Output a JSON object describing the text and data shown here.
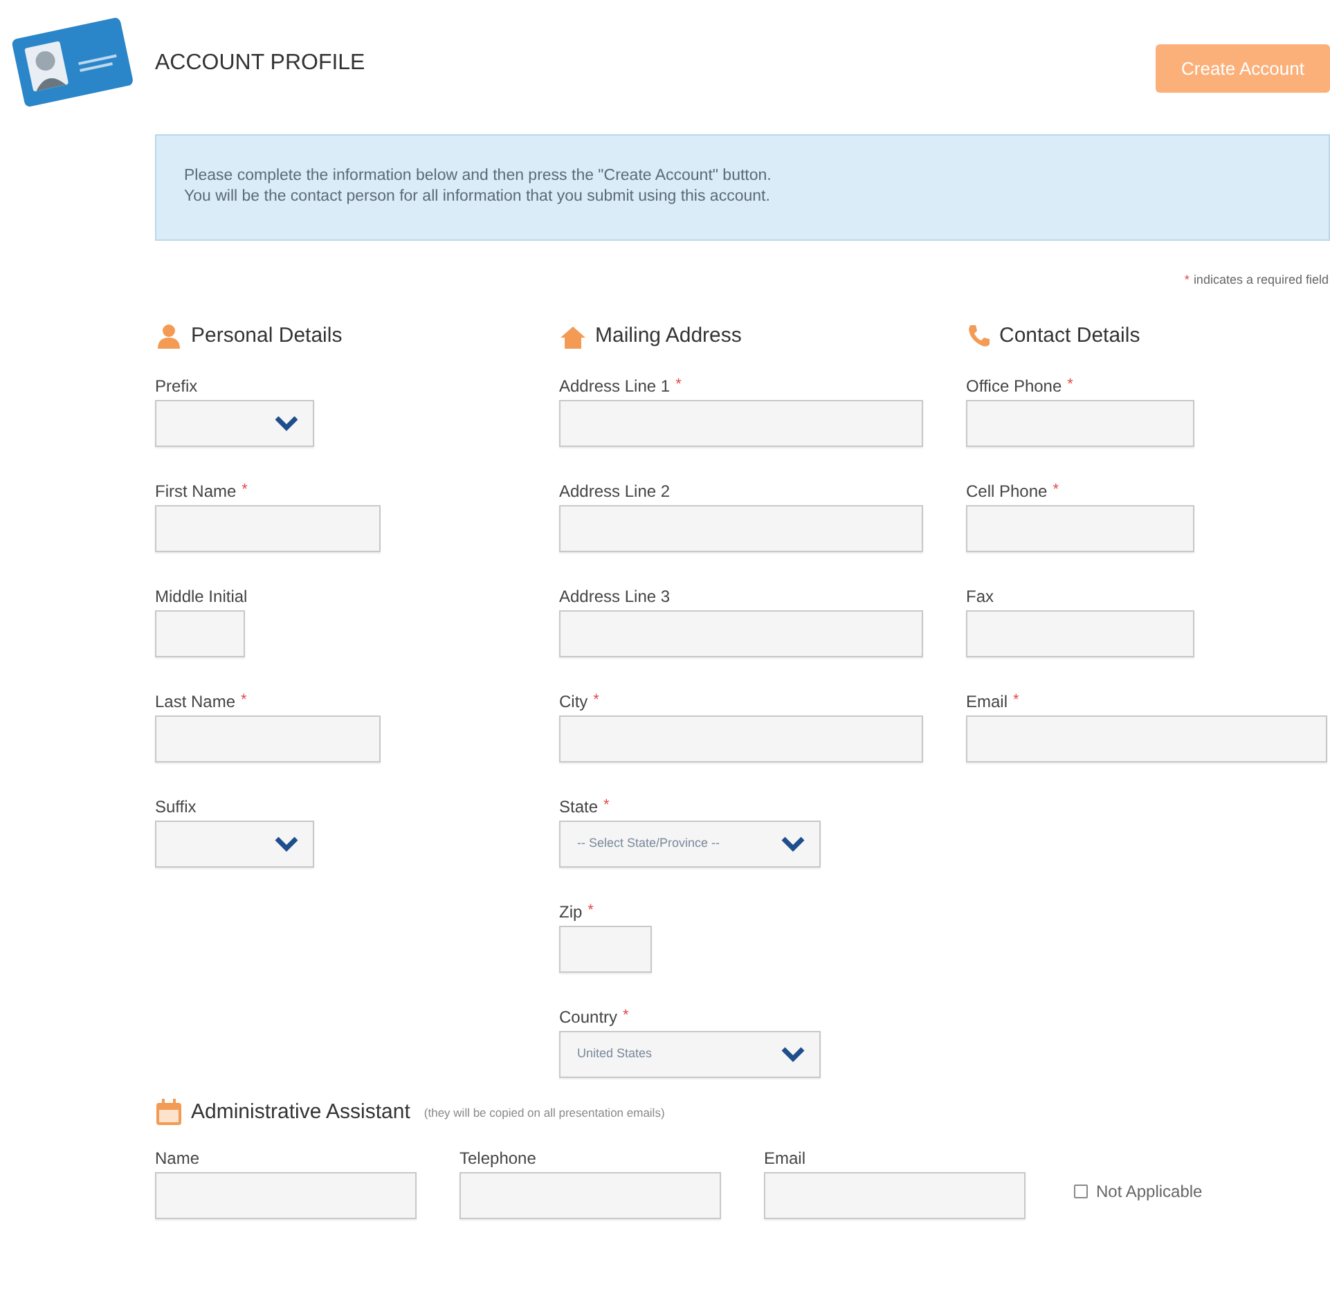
{
  "header": {
    "title": "ACCOUNT PROFILE",
    "button": "Create Account"
  },
  "notice": [
    "Please complete the information below and then press the \"Create Account\" button.",
    "You will be the contact person for all information that you submit using this account."
  ],
  "required_note": {
    "mark": "*",
    "text": "indicates a required field"
  },
  "sections": [
    {
      "title": "Personal Details",
      "fields": [
        {
          "label": "Prefix",
          "required": false,
          "kind": "select"
        },
        {
          "label": "First Name",
          "required": true,
          "kind": "text"
        },
        {
          "label": "Middle Initial",
          "required": false,
          "kind": "text"
        },
        {
          "label": "Last Name",
          "required": true,
          "kind": "text"
        },
        {
          "label": "Suffix",
          "required": false,
          "kind": "select"
        }
      ]
    },
    {
      "title": "Mailing Address",
      "fields": [
        {
          "label": "Address Line 1",
          "required": true,
          "kind": "text"
        },
        {
          "label": "Address Line 2",
          "required": false,
          "kind": "text"
        },
        {
          "label": "Address Line 3",
          "required": false,
          "kind": "text"
        },
        {
          "label": "City",
          "required": true,
          "kind": "text"
        },
        {
          "label": "State",
          "required": true,
          "kind": "select",
          "value": "-- Select State/Province --"
        },
        {
          "label": "Zip",
          "required": true,
          "kind": "text"
        },
        {
          "label": "Country",
          "required": true,
          "kind": "select",
          "value": "United States"
        }
      ]
    },
    {
      "title": "Contact Details",
      "fields": [
        {
          "label": "Office Phone",
          "required": true,
          "kind": "text"
        },
        {
          "label": "Cell Phone",
          "required": true,
          "kind": "text"
        },
        {
          "label": "Fax",
          "required": false,
          "kind": "text"
        },
        {
          "label": "Email",
          "required": true,
          "kind": "text"
        }
      ]
    }
  ],
  "assistant": {
    "title": "Administrative Assistant",
    "note": "(they will be copied on all presentation emails)",
    "fields": [
      {
        "label": "Name",
        "required": false,
        "kind": "text"
      },
      {
        "label": "Telephone",
        "required": false,
        "kind": "text"
      },
      {
        "label": "Email",
        "required": false,
        "kind": "text"
      }
    ],
    "not_applicable": {
      "label": "Not Applicable",
      "checked": false
    }
  }
}
